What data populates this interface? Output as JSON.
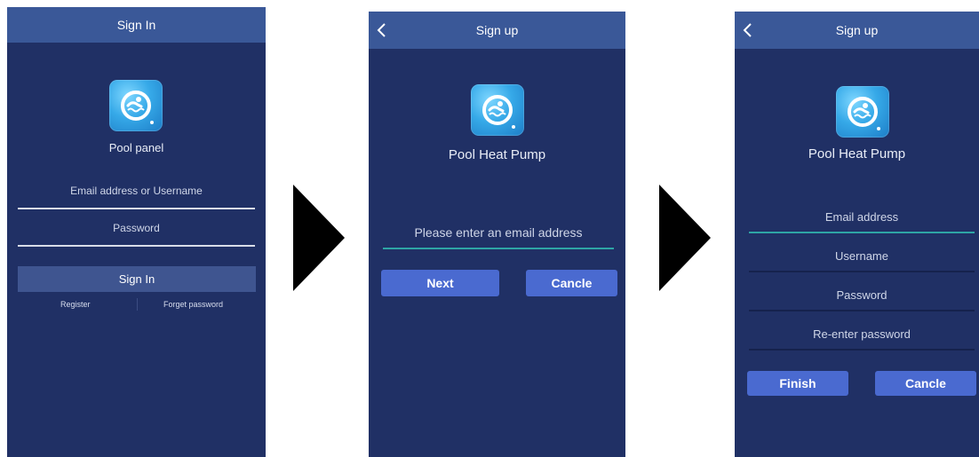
{
  "screens": [
    {
      "title": "Sign In",
      "app_name": "Pool panel",
      "email_placeholder": "Email address or Username",
      "password_placeholder": "Password",
      "sign_in_label": "Sign In",
      "register_label": "Register",
      "forget_label": "Forget password"
    },
    {
      "title": "Sign up",
      "app_name": "Pool Heat Pump",
      "email_placeholder": "Please enter an email address",
      "next_label": "Next",
      "cancel_label": "Cancle"
    },
    {
      "title": "Sign up",
      "app_name": "Pool Heat Pump",
      "email_placeholder": "Email address",
      "username_placeholder": "Username",
      "password_placeholder": "Password",
      "reenter_placeholder": "Re-enter password",
      "finish_label": "Finish",
      "cancel_label": "Cancle"
    }
  ],
  "icons": {
    "back": "chevron-left-icon",
    "logo": "swimmer-icon",
    "flow_arrow": "triangle-right-icon"
  },
  "colors": {
    "screen_bg": "#203065",
    "topbar_bg": "#3a5898",
    "button_bg": "#4a6ad0",
    "active_underline": "#2ea5a5"
  }
}
